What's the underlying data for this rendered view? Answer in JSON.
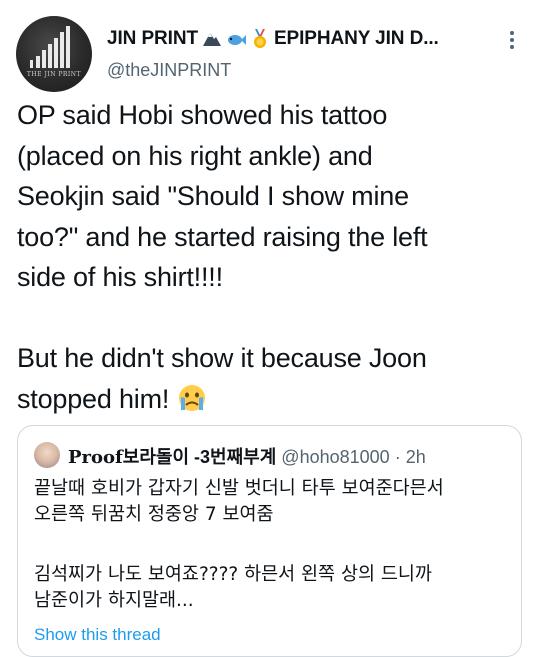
{
  "author": {
    "display_name_start": "JIN PRINT",
    "display_name_end": "EPIPHANY JIN D...",
    "emojis": [
      "mountain-icon",
      "fish-icon",
      "medal-icon"
    ],
    "handle": "@theJINPRINT",
    "avatar_text": "THE JIN PRINT"
  },
  "tweet": {
    "paragraph1": "OP said Hobi showed his tattoo\n(placed on his right ankle) and\nSeokjin said \"Should I show mine\ntoo?\" and he started raising the left\nside of his shirt!!!!",
    "paragraph2_line1": "But he didn't show it because Joon",
    "paragraph2_line2": "stopped him! ",
    "emoji": "crying-face-icon"
  },
  "quote": {
    "name_fraktur": "Proof",
    "name_rest": "보라돌이 -3번째부계",
    "handle": "@hoho81000",
    "separator": "·",
    "time": "2h",
    "body1": "끝날때 호비가 갑자기 신발 벗더니 타투 보여준다믄서\n오른쪽 뒤꿈치 정중앙 7 보여줌",
    "body2": "김석찌가 나도 보여죠???? 하믄서 왼쪽 상의 드니까\n남준이가 하지말래...",
    "link": "Show this thread"
  },
  "colors": {
    "text": "#0f1419",
    "muted": "#536471",
    "link": "#1d9bf0",
    "border": "#cfd9de"
  }
}
